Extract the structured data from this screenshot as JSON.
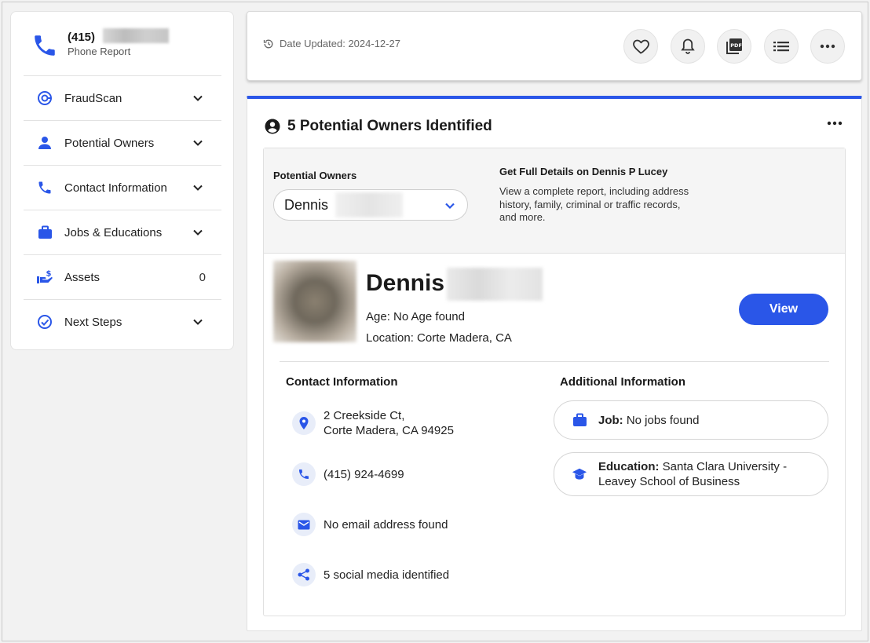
{
  "sidebar": {
    "phone_number": "(415)",
    "subtitle": "Phone Report",
    "items": [
      {
        "label": "FraudScan",
        "icon": "fraudscan-icon"
      },
      {
        "label": "Potential Owners",
        "icon": "person-icon"
      },
      {
        "label": "Contact Information",
        "icon": "phone-icon"
      },
      {
        "label": "Jobs & Educations",
        "icon": "briefcase-icon"
      },
      {
        "label": "Assets",
        "icon": "money-hand-icon",
        "count": "0"
      },
      {
        "label": "Next Steps",
        "icon": "check-circle-icon"
      }
    ]
  },
  "topbar": {
    "date_updated": "Date Updated: 2024-12-27",
    "actions": [
      "heart-icon",
      "bell-icon",
      "pdf-icon",
      "list-icon",
      "more-icon"
    ]
  },
  "main": {
    "title": "5 Potential Owners Identified",
    "potential_owners_label": "Potential Owners",
    "selected_owner": "Dennis",
    "full_details_title": "Get Full Details on Dennis P Lucey",
    "full_details_text": "View a complete report, including address history, family, criminal or traffic records, and more.",
    "person": {
      "first_name": "Dennis",
      "age": "Age: No Age found",
      "location": "Location: Corte Madera, CA",
      "view_label": "View"
    },
    "contact_title": "Contact Information",
    "address_line1": "2 Creekside Ct,",
    "address_line2": "Corte Madera, CA 94925",
    "phone": "(415) 924-4699",
    "email": "No email address found",
    "social": "5 social media identified",
    "additional_title": "Additional Information",
    "job_label": "Job:",
    "job_value": "No jobs found",
    "education_label": "Education:",
    "education_value": "Santa Clara University - Leavey School of Business"
  },
  "colors": {
    "accent": "#2a56e8",
    "background": "#f2f2f2"
  }
}
